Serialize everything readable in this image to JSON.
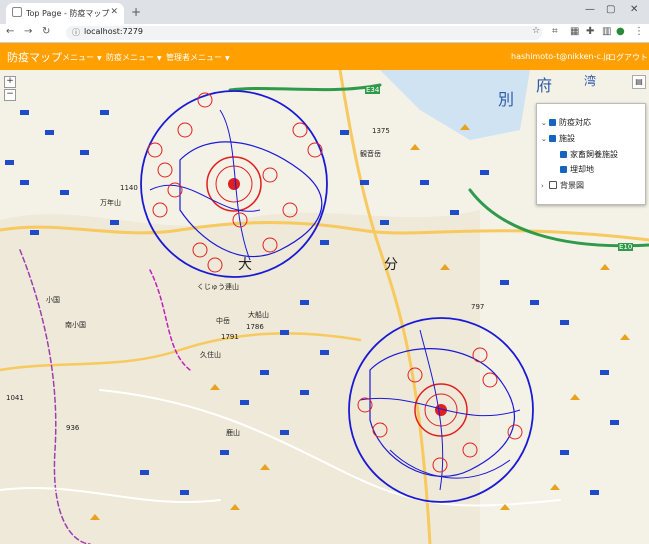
{
  "browser": {
    "tab_title": "Top Page - 防疫マップ",
    "url": "localhost:7279"
  },
  "appbar": {
    "brand": "防疫マップ",
    "menus": [
      "メニュー",
      "防疫メニュー",
      "管理者メニュー"
    ],
    "user_email": "hashimoto-t@nikken-c.jp",
    "logout": "ログアウト"
  },
  "layer_panel": {
    "items": [
      {
        "label": "防疫対応",
        "checked": true,
        "expanded": true
      },
      {
        "label": "施設",
        "checked": true,
        "expanded": true
      },
      {
        "label": "家畜飼養施設",
        "checked": true
      },
      {
        "label": "埋却地",
        "checked": true
      },
      {
        "label": "背景図",
        "checked": false,
        "expanded": false
      }
    ]
  },
  "map": {
    "zoom_in": "+",
    "zoom_out": "−",
    "labels": [
      "万年山",
      "1140",
      "大",
      "分",
      "くじゅう連山",
      "中岳",
      "1786",
      "1791",
      "久住山",
      "大船山",
      "小国",
      "南小国",
      "1041",
      "936",
      "鹿山",
      "1375",
      "観音岳",
      "797",
      "別",
      "府",
      "湾",
      "E34",
      "E10"
    ],
    "colors": {
      "zone_blue": "#1a1ad6",
      "zone_red": "#e02020",
      "accent": "#ffa000"
    }
  }
}
